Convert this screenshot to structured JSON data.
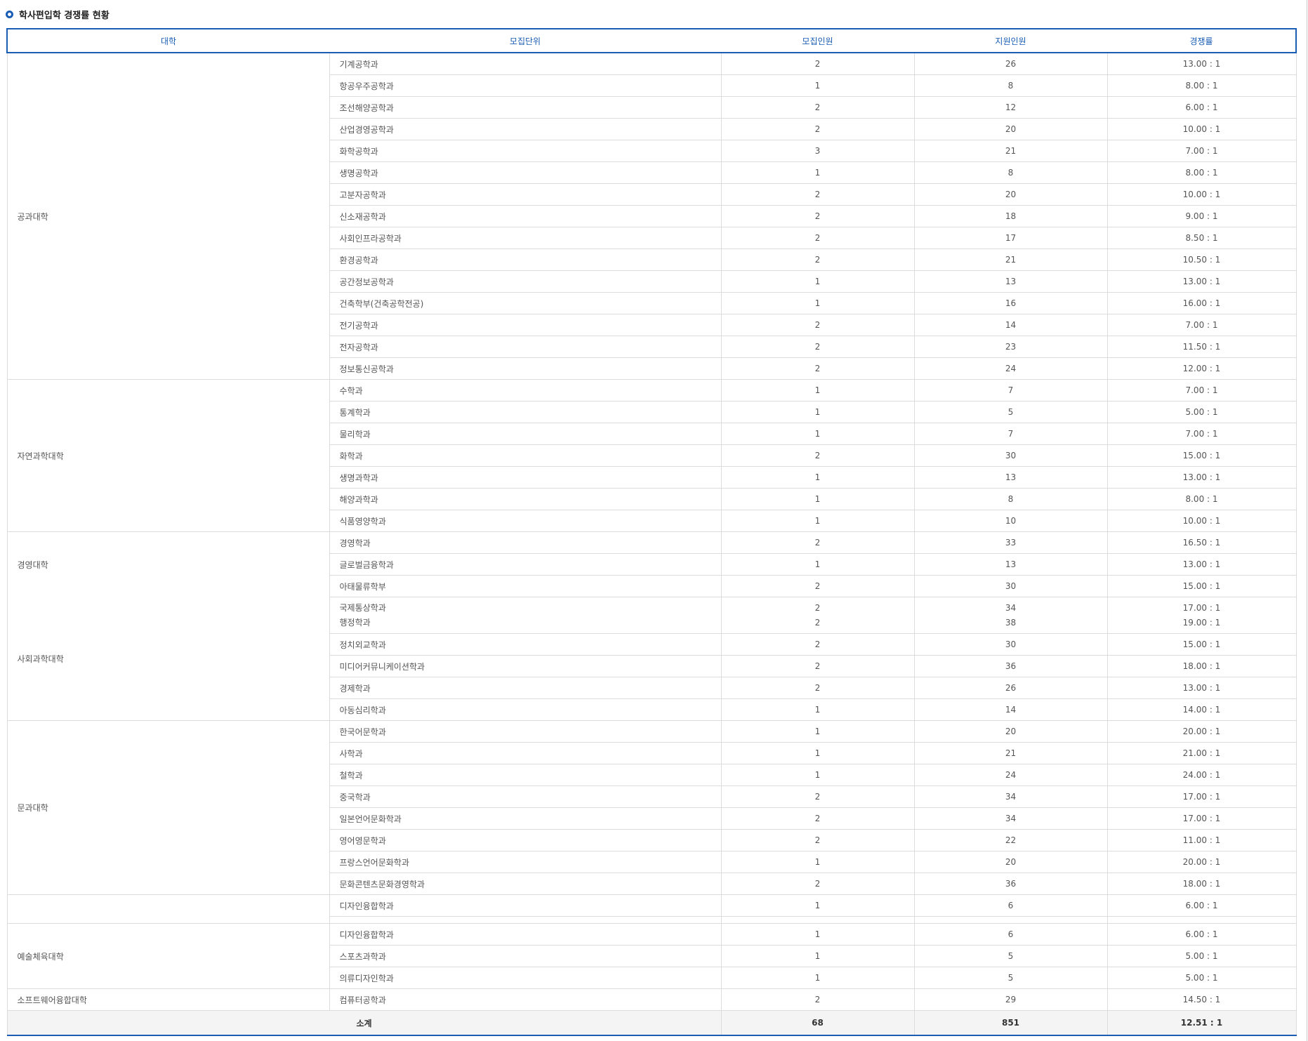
{
  "title": "학사편입학 경쟁률 현황",
  "table": {
    "headers": [
      "대학",
      "모집단위",
      "모집인원",
      "지원인원",
      "경쟁률"
    ],
    "groups": [
      {
        "college": "공과대학",
        "rows": [
          {
            "unit": "기계공학과",
            "quota": "2",
            "applicants": "26",
            "ratio": "13.00 : 1"
          },
          {
            "unit": "항공우주공학과",
            "quota": "1",
            "applicants": "8",
            "ratio": "8.00 : 1"
          },
          {
            "unit": "조선해양공학과",
            "quota": "2",
            "applicants": "12",
            "ratio": "6.00 : 1"
          },
          {
            "unit": "산업경영공학과",
            "quota": "2",
            "applicants": "20",
            "ratio": "10.00 : 1"
          },
          {
            "unit": "화학공학과",
            "quota": "3",
            "applicants": "21",
            "ratio": "7.00 : 1"
          },
          {
            "unit": "생명공학과",
            "quota": "1",
            "applicants": "8",
            "ratio": "8.00 : 1"
          },
          {
            "unit": "고분자공학과",
            "quota": "2",
            "applicants": "20",
            "ratio": "10.00 : 1"
          },
          {
            "unit": "신소재공학과",
            "quota": "2",
            "applicants": "18",
            "ratio": "9.00 : 1"
          },
          {
            "unit": "사회인프라공학과",
            "quota": "2",
            "applicants": "17",
            "ratio": "8.50 : 1"
          },
          {
            "unit": "환경공학과",
            "quota": "2",
            "applicants": "21",
            "ratio": "10.50 : 1"
          },
          {
            "unit": "공간정보공학과",
            "quota": "1",
            "applicants": "13",
            "ratio": "13.00 : 1"
          },
          {
            "unit": "건축학부(건축공학전공)",
            "quota": "1",
            "applicants": "16",
            "ratio": "16.00 : 1"
          },
          {
            "unit": "전기공학과",
            "quota": "2",
            "applicants": "14",
            "ratio": "7.00 : 1"
          },
          {
            "unit": "전자공학과",
            "quota": "2",
            "applicants": "23",
            "ratio": "11.50 : 1"
          },
          {
            "unit": "정보통신공학과",
            "quota": "2",
            "applicants": "24",
            "ratio": "12.00 : 1"
          }
        ]
      },
      {
        "college": "자연과학대학",
        "rows": [
          {
            "unit": "수학과",
            "quota": "1",
            "applicants": "7",
            "ratio": "7.00 : 1"
          },
          {
            "unit": "통계학과",
            "quota": "1",
            "applicants": "5",
            "ratio": "5.00 : 1"
          },
          {
            "unit": "물리학과",
            "quota": "1",
            "applicants": "7",
            "ratio": "7.00 : 1"
          },
          {
            "unit": "화학과",
            "quota": "2",
            "applicants": "30",
            "ratio": "15.00 : 1"
          },
          {
            "unit": "생명과학과",
            "quota": "1",
            "applicants": "13",
            "ratio": "13.00 : 1"
          },
          {
            "unit": "해양과학과",
            "quota": "1",
            "applicants": "8",
            "ratio": "8.00 : 1"
          },
          {
            "unit": "식품영양학과",
            "quota": "1",
            "applicants": "10",
            "ratio": "10.00 : 1"
          }
        ]
      },
      {
        "college_a": "경영대학",
        "college_b": "사회과학대학",
        "rows": [
          {
            "unit": "경영학과",
            "quota": "2",
            "applicants": "33",
            "ratio": "16.50 : 1"
          },
          {
            "unit": "글로벌금융학과",
            "quota": "1",
            "applicants": "13",
            "ratio": "13.00 : 1"
          },
          {
            "unit": "아태물류학부",
            "quota": "2",
            "applicants": "30",
            "ratio": "15.00 : 1"
          },
          {
            "unit": "국제통상학과",
            "unit2": "행정학과",
            "quota": "2",
            "quota2": "2",
            "applicants": "34",
            "applicants2": "38",
            "ratio": "17.00 : 1",
            "ratio2": "19.00 : 1"
          },
          {
            "unit": "정치외교학과",
            "quota": "2",
            "applicants": "30",
            "ratio": "15.00 : 1"
          },
          {
            "unit": "미디어커뮤니케이션학과",
            "quota": "2",
            "applicants": "36",
            "ratio": "18.00 : 1"
          },
          {
            "unit": "경제학과",
            "quota": "2",
            "applicants": "26",
            "ratio": "13.00 : 1"
          },
          {
            "unit": "아동심리학과",
            "quota": "1",
            "applicants": "14",
            "ratio": "14.00 : 1"
          }
        ]
      },
      {
        "college": "문과대학",
        "rows": [
          {
            "unit": "한국어문학과",
            "quota": "1",
            "applicants": "20",
            "ratio": "20.00 : 1"
          },
          {
            "unit": "사학과",
            "quota": "1",
            "applicants": "21",
            "ratio": "21.00 : 1"
          },
          {
            "unit": "철학과",
            "quota": "1",
            "applicants": "24",
            "ratio": "24.00 : 1"
          },
          {
            "unit": "중국학과",
            "quota": "2",
            "applicants": "34",
            "ratio": "17.00 : 1"
          },
          {
            "unit": "일본언어문화학과",
            "quota": "2",
            "applicants": "34",
            "ratio": "17.00 : 1"
          },
          {
            "unit": "영어영문학과",
            "quota": "2",
            "applicants": "22",
            "ratio": "11.00 : 1"
          },
          {
            "unit": "프랑스언어문화학과",
            "quota": "1",
            "applicants": "20",
            "ratio": "20.00 : 1"
          },
          {
            "unit": "문화콘텐츠문화경영학과",
            "quota": "2",
            "applicants": "36",
            "ratio": "18.00 : 1"
          }
        ]
      },
      {
        "college": "",
        "rows": [
          {
            "unit": "디자인융합학과",
            "quota": "1",
            "applicants": "6",
            "ratio": "6.00 : 1"
          }
        ]
      },
      {
        "college": "예술체육대학",
        "rows": [
          {
            "unit": "디자인융합학과",
            "quota": "1",
            "applicants": "6",
            "ratio": "6.00 : 1"
          },
          {
            "unit": "스포츠과학과",
            "quota": "1",
            "applicants": "5",
            "ratio": "5.00 : 1"
          },
          {
            "unit": "의류디자인학과",
            "quota": "1",
            "applicants": "5",
            "ratio": "5.00 : 1"
          }
        ]
      },
      {
        "college": "소프트웨어융합대학",
        "rows": [
          {
            "unit": "컴퓨터공학과",
            "quota": "2",
            "applicants": "29",
            "ratio": "14.50 : 1"
          }
        ]
      }
    ],
    "total": {
      "label": "소계",
      "quota": "68",
      "applicants": "851",
      "ratio": "12.51 : 1"
    }
  }
}
